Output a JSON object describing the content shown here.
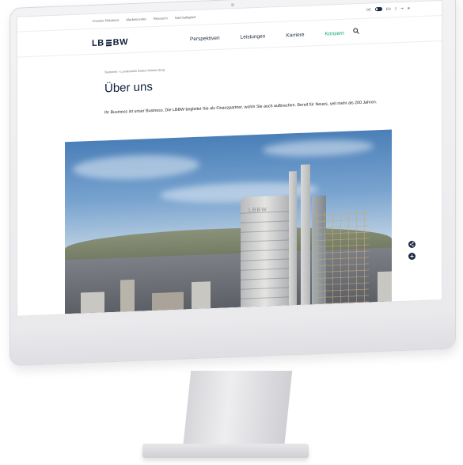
{
  "meta_nav": {
    "links": [
      "Investor Relations",
      "Medien­center",
      "Research",
      "Nachhaltigkeit"
    ],
    "lang_de": "DE",
    "lang_en": "EN"
  },
  "brand": {
    "logo_left": "LB",
    "logo_right": "BW"
  },
  "main_nav": {
    "items": [
      "Perspektiven",
      "Leistungen",
      "Karriere",
      "Konzern"
    ],
    "active_index": 3,
    "active_color": "#00a36f"
  },
  "breadcrumb": "Startseite  >  Landesbank Baden-Württemberg",
  "page": {
    "title": "Über uns",
    "intro": "Ihr Business ist unser Business. Die LBBW begleitet Sie als Finanzpartner, wohin Sie auch aufbrechen. Bereit für Neues, seit mehr als 200 Jahren."
  },
  "hero": {
    "tower_sign": "LBBW"
  },
  "side_actions": {
    "share_icon": "share-icon",
    "plus_icon": "plus-icon"
  },
  "colors": {
    "brand_navy": "#0f1f3a",
    "accent_green": "#00a36f"
  }
}
